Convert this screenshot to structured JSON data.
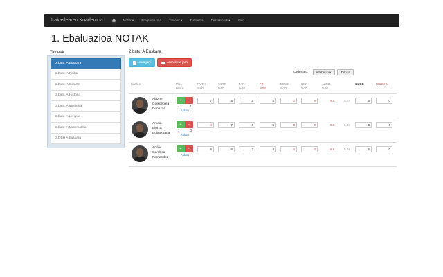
{
  "navbar": {
    "brand": "Irakaslearen Koadernoa",
    "items": [
      "Notak ▾",
      "Programazioa",
      "Taldeak ▾",
      "Tutoretza",
      "Desfaktorak ▾",
      "Irten"
    ]
  },
  "page": {
    "title": "1. Ebaluazioa NOTAK"
  },
  "sidebar": {
    "heading": "Taldeak",
    "items": [
      "2.batx. A Euskara",
      "2.batx. A Fisika",
      "2.batx. A Gizarte",
      "2.batx. A Historia",
      "2.batx. A Ingelesa",
      "2.batx. A Lengua",
      "2.batx. A Matematika",
      "3.DBH A Euskara"
    ]
  },
  "main": {
    "group_title": "2.batx. A Euskara",
    "save_label": "Laua jarri",
    "clear_label": "Aurreketa jarri",
    "order_label": "Ordenatu:",
    "sort_alpha": "Alfabetikoki",
    "sort_table": "Taloka"
  },
  "columns": {
    "ikaslea": "Ikaslea",
    "plus_minus": [
      "Plus",
      "Minus"
    ],
    "pyth": [
      "PYTH",
      "%00"
    ],
    "tart": [
      "TART",
      "%20"
    ],
    "jar": [
      "JAR",
      "%10"
    ],
    "fin": [
      "FIN",
      "%03"
    ],
    "demo": [
      "DEMO",
      "%20"
    ],
    "kkk": [
      "KKK",
      "%10"
    ],
    "azt": [
      "AZT11",
      "%20"
    ],
    "glob": "GLOB",
    "erreku": "ERREKU"
  },
  "students": [
    {
      "name": [
        "Alazne",
        "Goikoetxea",
        "Donazar"
      ],
      "plus": "4",
      "minus": "1",
      "link": "Aldatu",
      "grades": [
        "7",
        "5",
        "5",
        "5",
        "0",
        "8",
        "6.6"
      ],
      "glob": "5.07",
      "glob_in": "5",
      "erreku": "0"
    },
    {
      "name": [
        "Amaia",
        "Elorza",
        "Bolaokoaga"
      ],
      "plus": "1",
      "minus": "0",
      "link": "Aldatu",
      "grades": [
        "4",
        "7",
        "6",
        "5",
        "0",
        "0",
        "6.6"
      ],
      "glob": "5.69",
      "glob_in": "5",
      "erreku": "0"
    },
    {
      "name": [
        "Ander",
        "Gamboa",
        "Fernandez"
      ],
      "plus": "",
      "minus": "",
      "link": "Aldatu",
      "grades": [
        "5",
        "6",
        "7",
        "4",
        "4",
        "0",
        "6.6"
      ],
      "glob": "5.01",
      "glob_in": "5",
      "erreku": "0"
    }
  ],
  "colors": {
    "primary": "#337ab7",
    "info": "#5bc0de",
    "danger": "#d9534f",
    "success": "#5cb85c"
  }
}
